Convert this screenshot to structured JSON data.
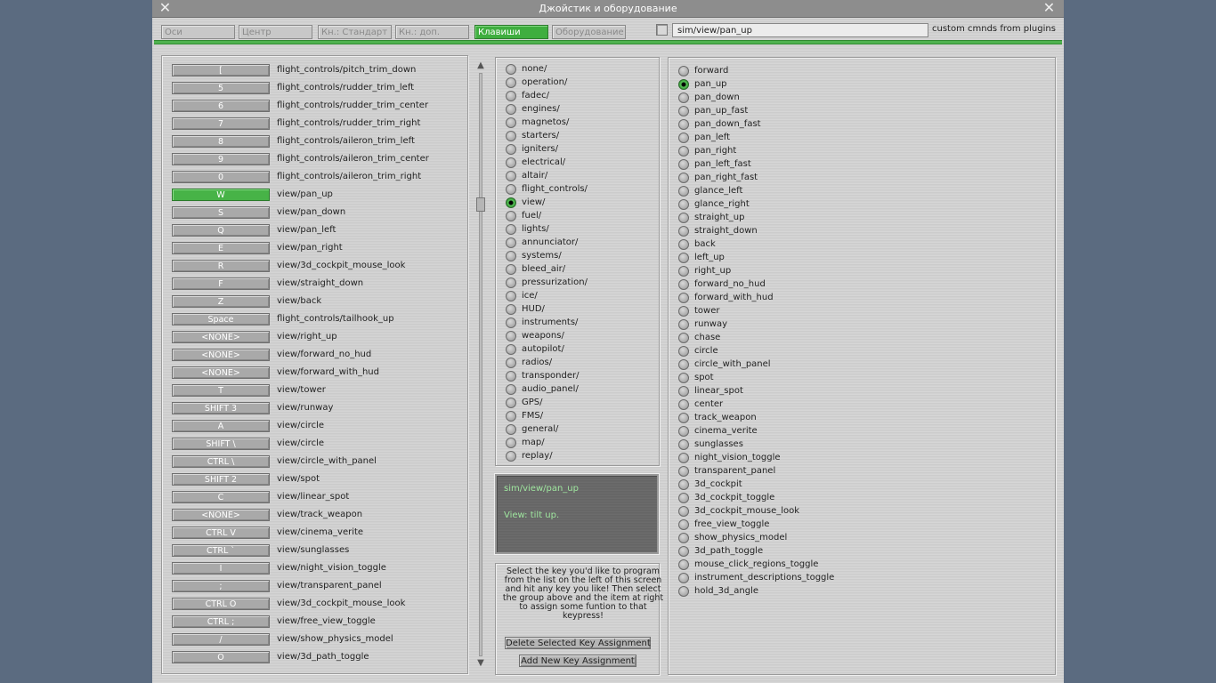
{
  "window": {
    "title": "Джойстик и оборудование"
  },
  "tabs": [
    {
      "label": "Оси",
      "active": false
    },
    {
      "label": "Центр",
      "active": false
    },
    {
      "label": "Кн.: Стандарт",
      "active": false
    },
    {
      "label": "Кн.: доп.",
      "active": false
    },
    {
      "label": "Клавиши",
      "active": true
    },
    {
      "label": "Оборудование",
      "active": false
    }
  ],
  "command_search": {
    "value": "sim/view/pan_up",
    "plugins_label": "custom cmnds from plugins"
  },
  "key_assignments": [
    {
      "key": "[",
      "command": "flight_controls/pitch_trim_down"
    },
    {
      "key": "5",
      "command": "flight_controls/rudder_trim_left"
    },
    {
      "key": "6",
      "command": "flight_controls/rudder_trim_center"
    },
    {
      "key": "7",
      "command": "flight_controls/rudder_trim_right"
    },
    {
      "key": "8",
      "command": "flight_controls/aileron_trim_left"
    },
    {
      "key": "9",
      "command": "flight_controls/aileron_trim_center"
    },
    {
      "key": "0",
      "command": "flight_controls/aileron_trim_right"
    },
    {
      "key": "W",
      "command": "view/pan_up",
      "selected": true
    },
    {
      "key": "S",
      "command": "view/pan_down"
    },
    {
      "key": "Q",
      "command": "view/pan_left"
    },
    {
      "key": "E",
      "command": "view/pan_right"
    },
    {
      "key": "R",
      "command": "view/3d_cockpit_mouse_look"
    },
    {
      "key": "F",
      "command": "view/straight_down"
    },
    {
      "key": "Z",
      "command": "view/back"
    },
    {
      "key": "Space",
      "command": "flight_controls/tailhook_up"
    },
    {
      "key": "<NONE>",
      "command": "view/right_up"
    },
    {
      "key": "<NONE>",
      "command": "view/forward_no_hud"
    },
    {
      "key": "<NONE>",
      "command": "view/forward_with_hud"
    },
    {
      "key": "T",
      "command": "view/tower"
    },
    {
      "key": "SHIFT 3",
      "command": "view/runway"
    },
    {
      "key": "A",
      "command": "view/circle"
    },
    {
      "key": "SHIFT \\",
      "command": "view/circle"
    },
    {
      "key": "CTRL \\",
      "command": "view/circle_with_panel"
    },
    {
      "key": "SHIFT 2",
      "command": "view/spot"
    },
    {
      "key": "C",
      "command": "view/linear_spot"
    },
    {
      "key": "<NONE>",
      "command": "view/track_weapon"
    },
    {
      "key": "CTRL V",
      "command": "view/cinema_verite"
    },
    {
      "key": "CTRL `",
      "command": "view/sunglasses"
    },
    {
      "key": "I",
      "command": "view/night_vision_toggle"
    },
    {
      "key": ";",
      "command": "view/transparent_panel"
    },
    {
      "key": "CTRL O",
      "command": "view/3d_cockpit_mouse_look"
    },
    {
      "key": "CTRL ;",
      "command": "view/free_view_toggle"
    },
    {
      "key": "/",
      "command": "view/show_physics_model"
    },
    {
      "key": "O",
      "command": "view/3d_path_toggle"
    }
  ],
  "groups": [
    {
      "label": "none/"
    },
    {
      "label": "operation/"
    },
    {
      "label": "fadec/"
    },
    {
      "label": "engines/"
    },
    {
      "label": "magnetos/"
    },
    {
      "label": "starters/"
    },
    {
      "label": "igniters/"
    },
    {
      "label": "electrical/"
    },
    {
      "label": "altair/"
    },
    {
      "label": "flight_controls/"
    },
    {
      "label": "view/",
      "selected": true
    },
    {
      "label": "fuel/"
    },
    {
      "label": "lights/"
    },
    {
      "label": "annunciator/"
    },
    {
      "label": "systems/"
    },
    {
      "label": "bleed_air/"
    },
    {
      "label": "pressurization/"
    },
    {
      "label": "ice/"
    },
    {
      "label": "HUD/"
    },
    {
      "label": "instruments/"
    },
    {
      "label": "weapons/"
    },
    {
      "label": "autopilot/"
    },
    {
      "label": "radios/"
    },
    {
      "label": "transponder/"
    },
    {
      "label": "audio_panel/"
    },
    {
      "label": "GPS/"
    },
    {
      "label": "FMS/"
    },
    {
      "label": "general/"
    },
    {
      "label": "map/"
    },
    {
      "label": "replay/"
    }
  ],
  "description": {
    "command": "sim/view/pan_up",
    "text": "View: tilt up."
  },
  "help": {
    "lines": [
      "Select the key you'd like to program",
      "from the list on the left of this screen",
      "and hit any key you like! Then select",
      "the group above and the item at right",
      "to assign some funtion to that keypress!"
    ],
    "delete_label": "Delete Selected Key Assignment",
    "add_label": "Add New Key Assignment"
  },
  "commands": [
    {
      "label": "forward"
    },
    {
      "label": "pan_up",
      "selected": true
    },
    {
      "label": "pan_down"
    },
    {
      "label": "pan_up_fast"
    },
    {
      "label": "pan_down_fast"
    },
    {
      "label": "pan_left"
    },
    {
      "label": "pan_right"
    },
    {
      "label": "pan_left_fast"
    },
    {
      "label": "pan_right_fast"
    },
    {
      "label": "glance_left"
    },
    {
      "label": "glance_right"
    },
    {
      "label": "straight_up"
    },
    {
      "label": "straight_down"
    },
    {
      "label": "back"
    },
    {
      "label": "left_up"
    },
    {
      "label": "right_up"
    },
    {
      "label": "forward_no_hud"
    },
    {
      "label": "forward_with_hud"
    },
    {
      "label": "tower"
    },
    {
      "label": "runway"
    },
    {
      "label": "chase"
    },
    {
      "label": "circle"
    },
    {
      "label": "circle_with_panel"
    },
    {
      "label": "spot"
    },
    {
      "label": "linear_spot"
    },
    {
      "label": "center"
    },
    {
      "label": "track_weapon"
    },
    {
      "label": "cinema_verite"
    },
    {
      "label": "sunglasses"
    },
    {
      "label": "night_vision_toggle"
    },
    {
      "label": "transparent_panel"
    },
    {
      "label": "3d_cockpit"
    },
    {
      "label": "3d_cockpit_toggle"
    },
    {
      "label": "3d_cockpit_mouse_look"
    },
    {
      "label": "free_view_toggle"
    },
    {
      "label": "show_physics_model"
    },
    {
      "label": "3d_path_toggle"
    },
    {
      "label": "mouse_click_regions_toggle"
    },
    {
      "label": "instrument_descriptions_toggle"
    },
    {
      "label": "hold_3d_angle"
    }
  ]
}
